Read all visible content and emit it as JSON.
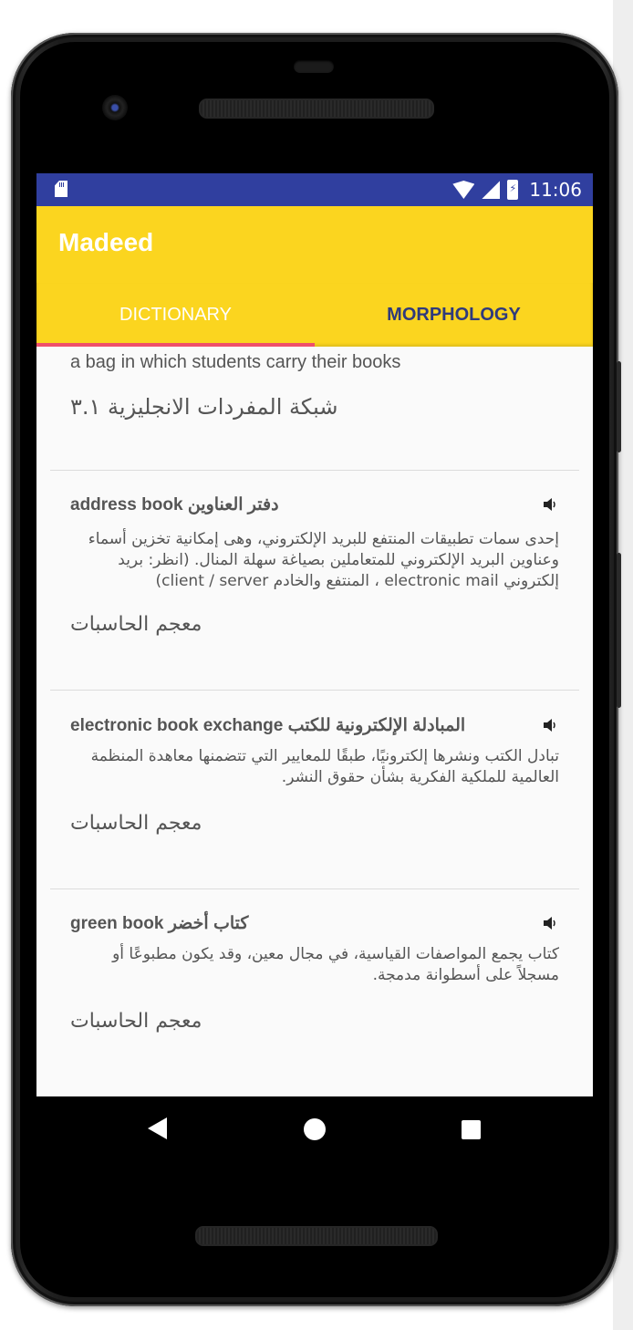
{
  "statusbar": {
    "time": "11:06"
  },
  "app": {
    "title": "Madeed"
  },
  "tabs": [
    {
      "label": "DICTIONARY",
      "active": true
    },
    {
      "label": "MORPHOLOGY",
      "active": false
    }
  ],
  "top_entry": {
    "definition": "a bag in which students carry their books",
    "source": "شبكة المفردات الانجليزية ٣.١"
  },
  "entries": [
    {
      "title": "address book دفتر العناوين",
      "body": "إحدى سمات تطبيقات المنتفع للبريد الإلكتروني، وهى إمكانية تخزين أسماء وعناوين البريد الإلكتروني للمتعاملين بصياغة سهلة المنال. (انظر: بريد إلكتروني electronic mail ، المنتفع والخادم client / server)",
      "source": "معجم الحاسبات"
    },
    {
      "title": "electronic book exchange المبادلة الإلكترونية للكتب",
      "body": "تبادل الكتب ونشرها إلكترونيًا، طبقًا للمعايير التي تتضمنها معاهدة المنظمة العالمية للملكية الفكرية بشأن حقوق النشر.",
      "source": "معجم الحاسبات"
    },
    {
      "title": "green book كتاب أخضر",
      "body": "كتاب يجمع المواصفات القياسية، في مجال معين، وقد يكون مطبوعًا أو مسجلاً على أسطوانة مدمجة.",
      "source": "معجم الحاسبات"
    }
  ],
  "colors": {
    "status_bar": "#303f9f",
    "app_bar": "#fbd51f",
    "tab_indicator": "#ef4f6a",
    "inactive_tab_text": "#2f3a7c"
  },
  "icons": [
    "sd-card-icon",
    "wifi-icon",
    "cell-signal-icon",
    "battery-charging-icon",
    "speaker-icon",
    "back-icon",
    "home-icon",
    "recents-icon"
  ]
}
